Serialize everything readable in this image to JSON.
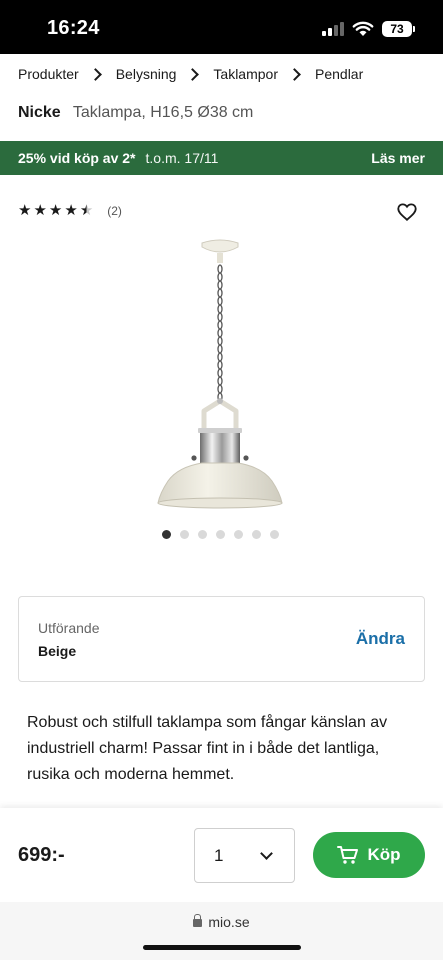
{
  "status_bar": {
    "time": "16:24",
    "battery": "73"
  },
  "breadcrumb": [
    "Produkter",
    "Belysning",
    "Taklampor",
    "Pendlar"
  ],
  "product": {
    "brand": "Nicke",
    "model": "Taklampa, H16,5 Ø38 cm"
  },
  "promo": {
    "main": "25% vid köp av 2*",
    "date": "t.o.m. 17/11",
    "link": "Läs mer"
  },
  "rating": {
    "stars": 4.5,
    "count": "(2)"
  },
  "gallery": {
    "image_count": 7,
    "active_index": 0
  },
  "variant": {
    "label": "Utförande",
    "value": "Beige",
    "change": "Ändra"
  },
  "description": "Robust och stilfull taklampa som fångar känslan av industriell charm! Passar fint in i både det lantliga, rusika och moderna hemmet.",
  "buy": {
    "price": "699:-",
    "quantity": "1",
    "button": "Köp"
  },
  "browser": {
    "url": "mio.se"
  },
  "colors": {
    "promo_bg": "#2b6b3d",
    "buy_button": "#2fa84a",
    "link": "#1b6fa8"
  }
}
